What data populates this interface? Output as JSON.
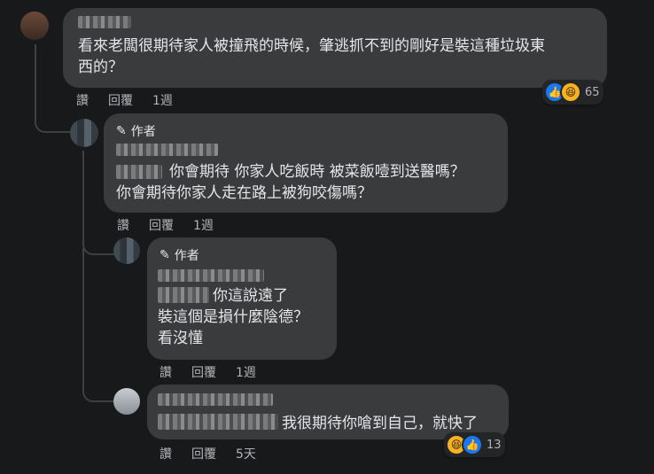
{
  "comments": [
    {
      "text_lines": [
        "看來老闆很期待家人被撞飛的時候，肇逃抓不到的剛好是裝這種垃圾東",
        "西的？"
      ],
      "actions": {
        "like": "讚",
        "reply": "回覆",
        "time": "1週"
      },
      "reactions": {
        "icons": [
          "like-icon",
          "haha-icon"
        ],
        "count": "65"
      }
    },
    {
      "author_badge": "作者",
      "text_lines": [
        "你會期待 你家人吃飯時 被菜飯噎到送醫嗎？",
        "你會期待你家人走在路上被狗咬傷嗎？"
      ],
      "actions": {
        "like": "讚",
        "reply": "回覆",
        "time": "1週"
      }
    },
    {
      "author_badge": "作者",
      "text_lines": [
        "你這說遠了",
        "裝這個是損什麼陰德？",
        "看沒懂"
      ],
      "actions": {
        "like": "讚",
        "reply": "回覆",
        "time": "1週"
      }
    },
    {
      "text_lines": [
        "我很期待你嗆到自己，就快了"
      ],
      "actions": {
        "like": "讚",
        "reply": "回覆",
        "time": "5天"
      },
      "reactions": {
        "icons": [
          "haha-icon",
          "like-icon"
        ],
        "count": "13"
      }
    }
  ],
  "colors": {
    "background": "#18191a",
    "bubble": "#3a3b3c",
    "like": "#1877f2",
    "haha": "#f7b125"
  }
}
